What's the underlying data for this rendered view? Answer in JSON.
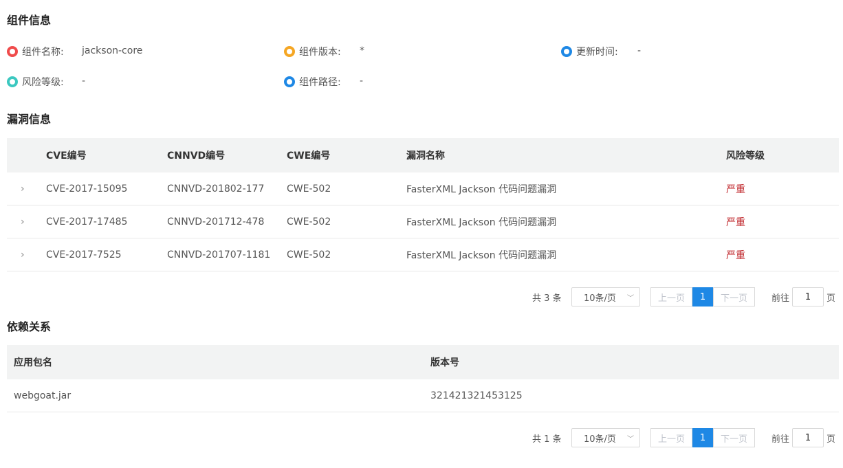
{
  "component_section": {
    "title": "组件信息",
    "items": [
      {
        "label": "组件名称:",
        "value": "jackson-core",
        "color": "#f04b4b"
      },
      {
        "label": "组件版本:",
        "value": "*",
        "color": "#f5a623"
      },
      {
        "label": "更新时间:",
        "value": "-",
        "color": "#1e88e5"
      },
      {
        "label": "风险等级:",
        "value": "-",
        "color": "#3cc8c0"
      },
      {
        "label": "组件路径:",
        "value": "-",
        "color": "#1e88e5"
      }
    ]
  },
  "vuln_section": {
    "title": "漏洞信息",
    "headers": [
      "CVE编号",
      "CNNVD编号",
      "CWE编号",
      "漏洞名称",
      "风险等级"
    ],
    "rows": [
      {
        "cve": "CVE-2017-15095",
        "cnnvd": "CNNVD-201802-177",
        "cwe": "CWE-502",
        "name": "FasterXML Jackson 代码问题漏洞",
        "severity": "严重"
      },
      {
        "cve": "CVE-2017-17485",
        "cnnvd": "CNNVD-201712-478",
        "cwe": "CWE-502",
        "name": "FasterXML Jackson 代码问题漏洞",
        "severity": "严重"
      },
      {
        "cve": "CVE-2017-7525",
        "cnnvd": "CNNVD-201707-1181",
        "cwe": "CWE-502",
        "name": "FasterXML Jackson 代码问题漏洞",
        "severity": "严重"
      }
    ],
    "pager": {
      "total": "共 3 条",
      "page_size": "10条/页",
      "prev": "上一页",
      "current": "1",
      "next": "下一页",
      "goto": "前往",
      "goto_value": "1",
      "page_unit": "页"
    }
  },
  "dep_section": {
    "title": "依赖关系",
    "headers": [
      "应用包名",
      "版本号"
    ],
    "rows": [
      {
        "package": "webgoat.jar",
        "version": "321421321453125"
      }
    ],
    "pager": {
      "total": "共 1 条",
      "page_size": "10条/页",
      "prev": "上一页",
      "current": "1",
      "next": "下一页",
      "goto": "前往",
      "goto_value": "1",
      "page_unit": "页"
    }
  },
  "colors": {
    "accent": "#1e88e5",
    "severity_high": "#c0282d"
  }
}
